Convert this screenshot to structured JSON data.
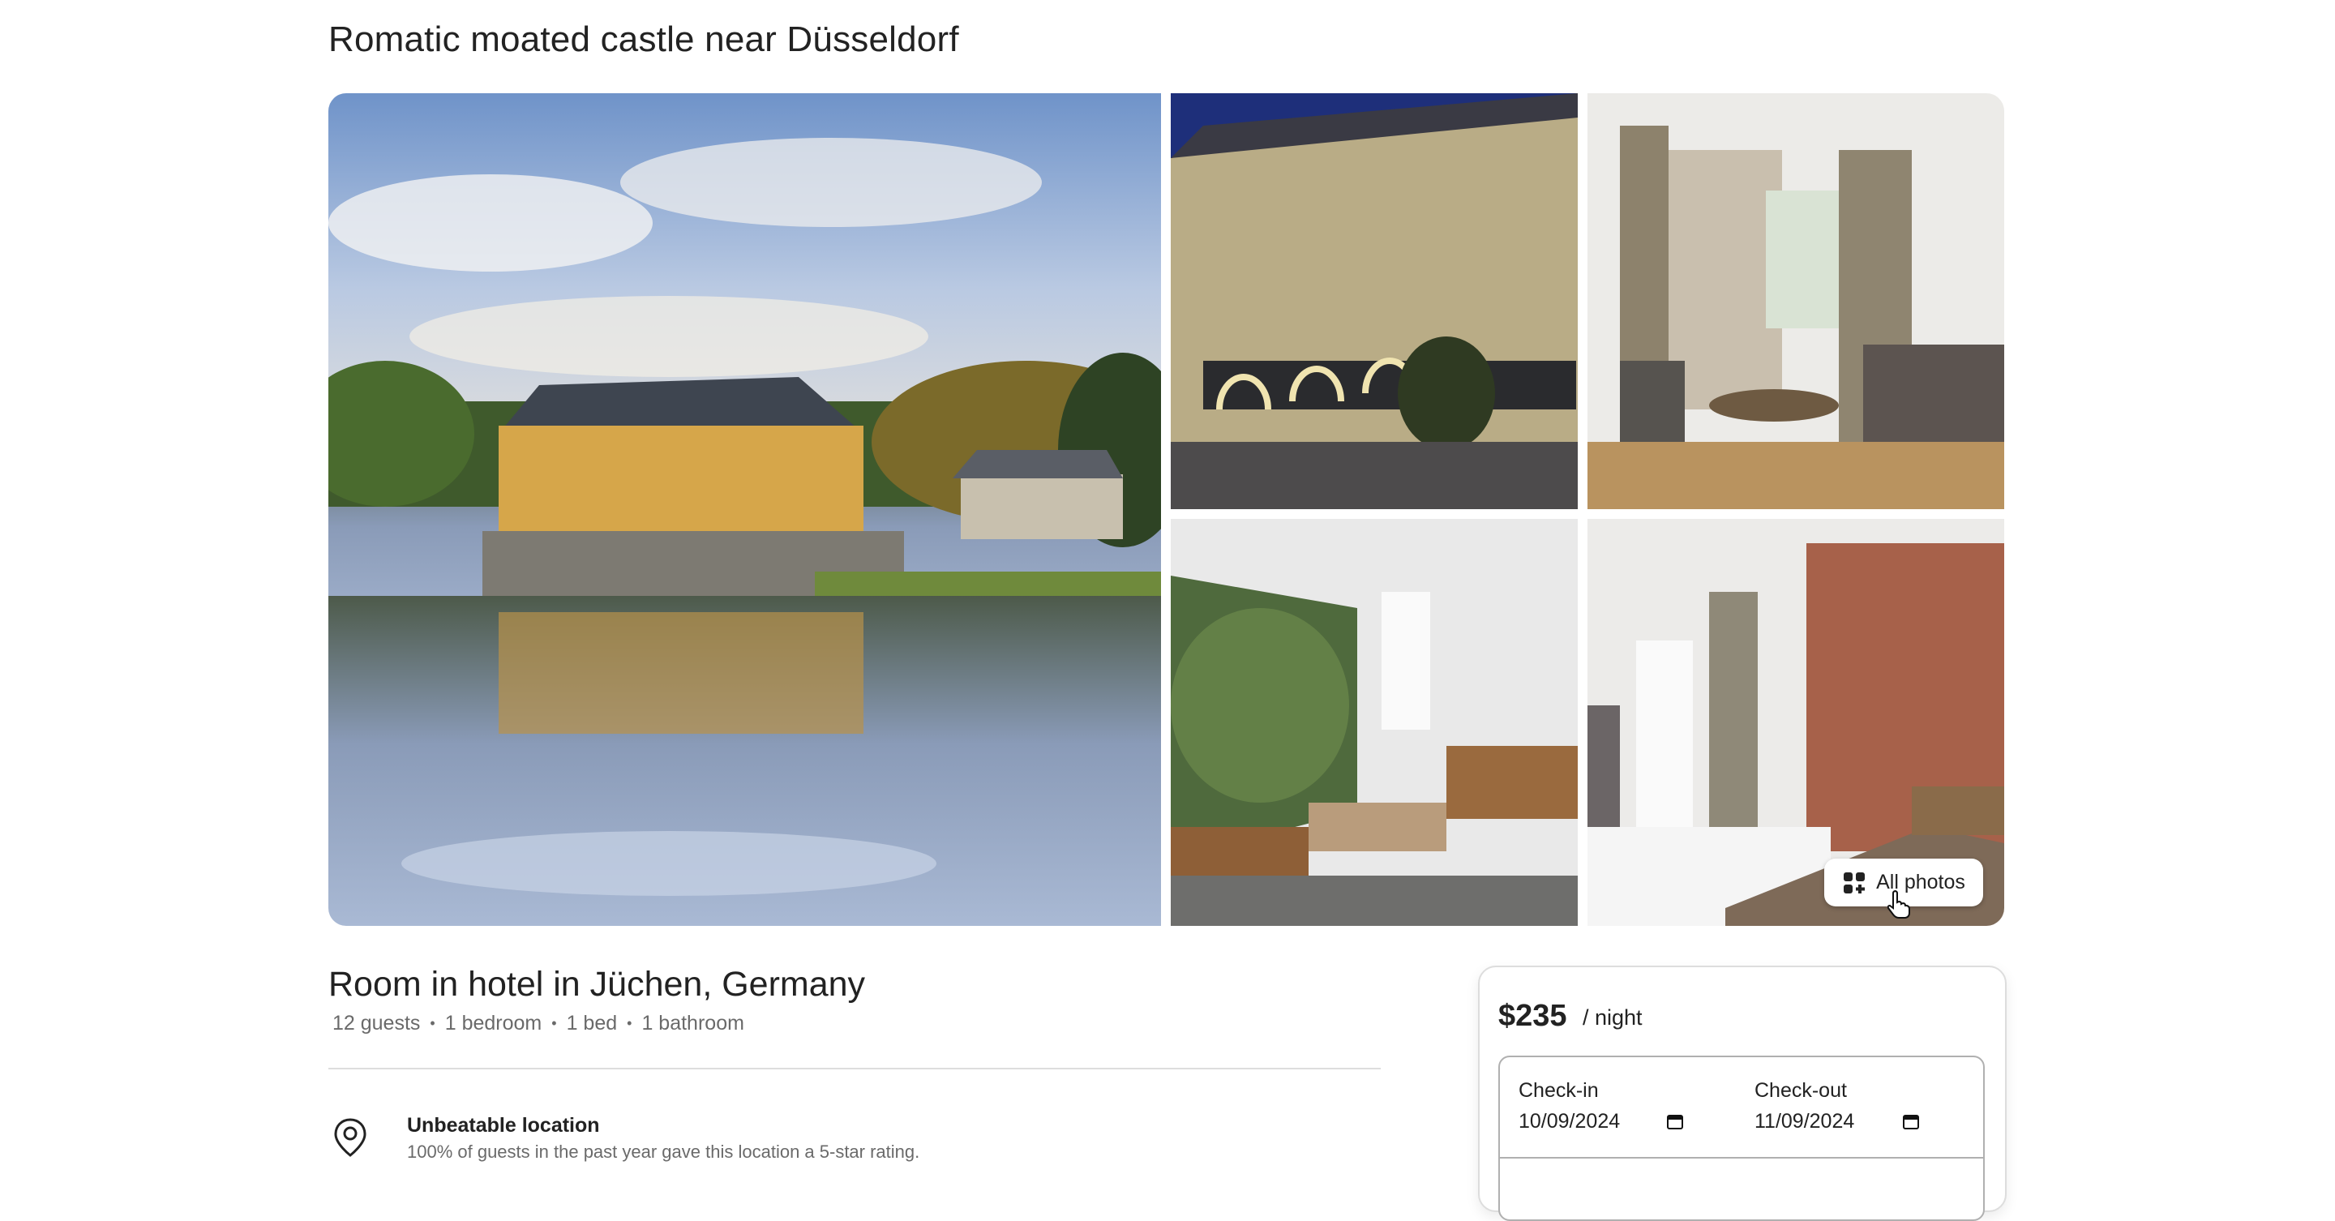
{
  "listing": {
    "title": "Romatic moated castle near Düsseldorf",
    "all_photos_label": "All photos",
    "subtitle": "Room in hotel in Jüchen, Germany",
    "facts": [
      "12 guests",
      "1 bedroom",
      "1 bed",
      "1 bathroom"
    ],
    "highlight": {
      "title": "Unbeatable location",
      "description": "100% of guests in the past year gave this location a 5-star rating."
    }
  },
  "booking": {
    "price": "$235",
    "per": "/ night",
    "checkin_label": "Check-in",
    "checkin_value": "10/09/2024",
    "checkout_label": "Check-out",
    "checkout_value": "11/09/2024"
  },
  "colors": {
    "text": "#222222",
    "muted": "#6a6a6a",
    "border": "#dddddd"
  },
  "icons": [
    "grid-icon",
    "location-pin-icon",
    "calendar-icon",
    "pointer-cursor-icon"
  ]
}
